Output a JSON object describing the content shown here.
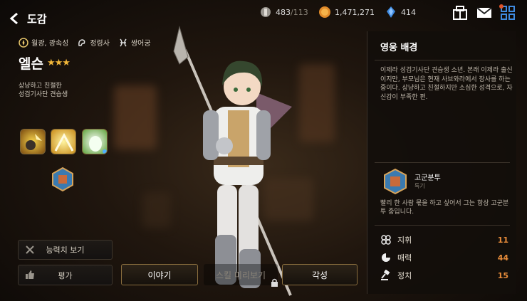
{
  "header": {
    "title": "도감",
    "back_icon": "back-arrow-icon"
  },
  "resources": {
    "stamina": {
      "icon": "stamina-icon",
      "value": "483",
      "max": "/113"
    },
    "gold": {
      "icon": "gold-coin-icon",
      "value": "1,471,271"
    },
    "gems": {
      "icon": "gem-icon",
      "value": "414"
    }
  },
  "top_icons": [
    "guild-icon",
    "mail-icon",
    "menu-grid-icon"
  ],
  "hero": {
    "attributes": [
      "월광, 광속성",
      "정령사",
      "쌍어궁"
    ],
    "name": "엘슨",
    "stars": "★★★",
    "description_line1": "상냥하고 친절한",
    "description_line2": "성검기사단 견습생"
  },
  "left_buttons": {
    "stats": "능력치 보기",
    "rate": "평가"
  },
  "tabs": {
    "story": "이야기",
    "skill_preview": "스킬 미리보기",
    "awaken": "각성"
  },
  "right_panel": {
    "title": "영웅 배경",
    "story": "이제라 성검기사단 견습생 소년. 본래 이제라 출신이지만, 부모님은 현재 사브와라에서 장사를 하는 중이다. 상냥하고 친절하지만 소심한 성격으로, 자신감이 부족한 편.",
    "trait_name": "고군분투",
    "trait_type": "특기",
    "trait_desc": "빨리 한 사람 몫을 하고 싶어서 그는 항상 고군분투 중입니다.",
    "stats": [
      {
        "label": "지휘",
        "value": "11"
      },
      {
        "label": "매력",
        "value": "44"
      },
      {
        "label": "정치",
        "value": "15"
      }
    ]
  },
  "colors": {
    "accent_gold": "#f2b73a",
    "stat_value": "#e88c3a",
    "gem_blue": "#3f8be0"
  }
}
